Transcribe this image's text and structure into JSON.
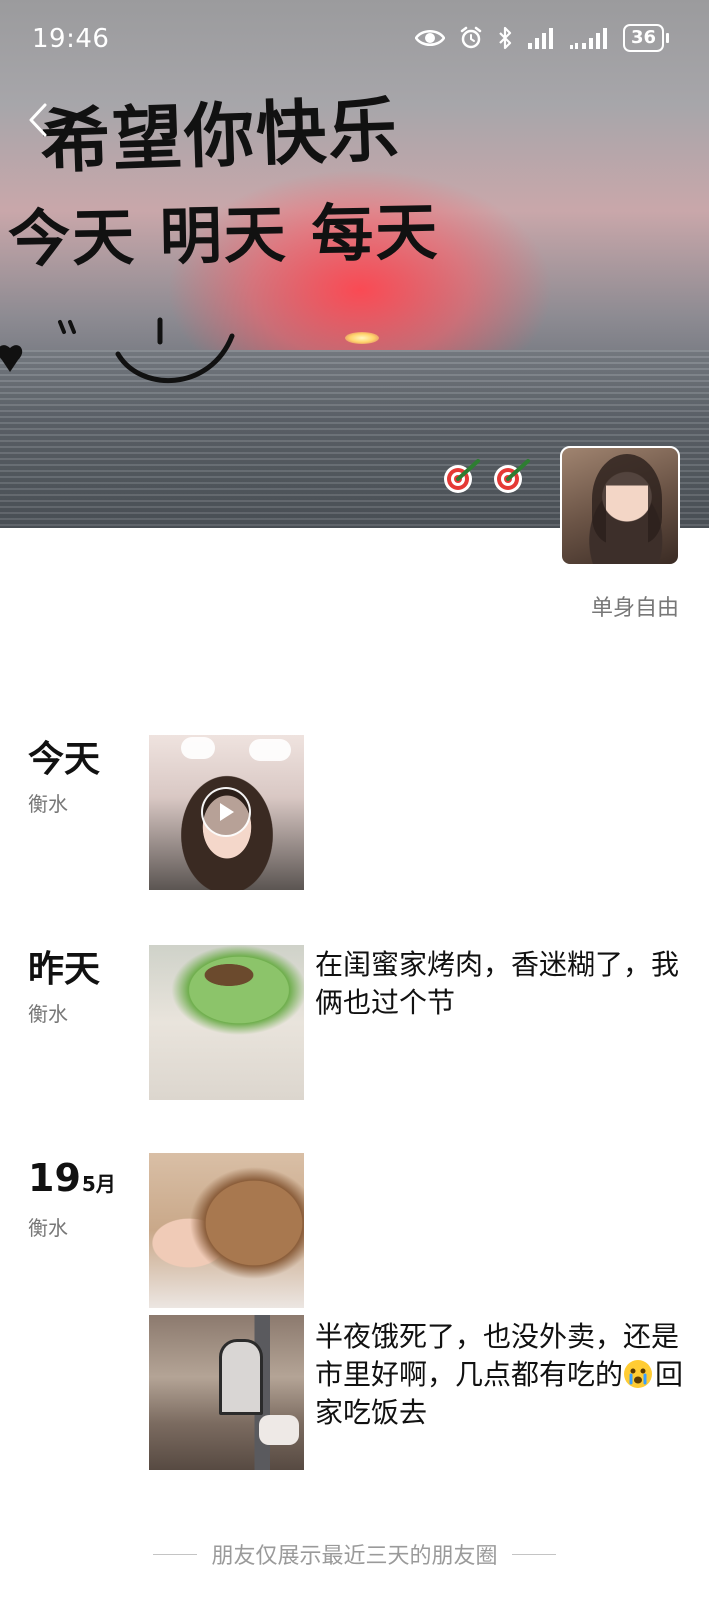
{
  "status_bar": {
    "time": "19:46",
    "battery": "36",
    "icons": [
      "eye-icon",
      "alarm-icon",
      "bluetooth-icon",
      "signal-icon",
      "signal-icon"
    ]
  },
  "header": {
    "back_icon": "chevron-left-icon"
  },
  "cover": {
    "line1": "希望你快乐",
    "line2": "今天 明天 每天",
    "decor_icons": [
      "heart-icon",
      "smiley-icon",
      "dart-target-icon",
      "dart-target-icon"
    ]
  },
  "profile": {
    "signature": "单身自由"
  },
  "posts": [
    {
      "day_label": "今天",
      "location": "衡水",
      "media": [
        "video"
      ],
      "text": ""
    },
    {
      "day_label": "昨天",
      "location": "衡水",
      "media": [
        "photo"
      ],
      "text": "在闺蜜家烤肉，香迷糊了，我俩也过个节"
    },
    {
      "day_number": "19",
      "month": "5月",
      "location": "衡水",
      "media": [
        "photo"
      ],
      "text": ""
    },
    {
      "media": [
        "photo"
      ],
      "text_before_emoji": "半夜饿死了，也没外卖，还是市里好啊，几点都有吃的",
      "emoji": "crying-face-emoji",
      "text_after_emoji": "回家吃饭去"
    }
  ],
  "footer": {
    "note": "朋友仅展示最近三天的朋友圈"
  },
  "colors": {
    "background": "#ffffff",
    "text_primary": "#111111",
    "text_secondary": "#777777",
    "footer_text": "#9a9a9a"
  }
}
